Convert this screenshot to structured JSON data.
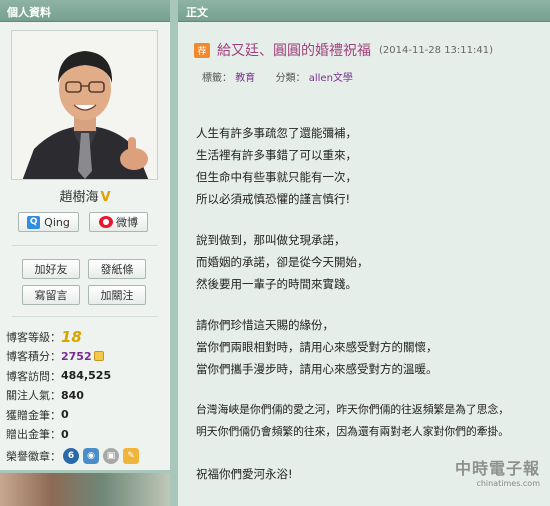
{
  "profile_panel": {
    "title": "個人資料",
    "name": "趙樹海",
    "vip_mark": "V",
    "buttons": {
      "qing": "Qing",
      "weibo": "微博",
      "add_friend": "加好友",
      "send_note": "發紙條",
      "write_message": "寫留言",
      "follow": "加關注"
    },
    "stats": [
      {
        "label": "博客等級：",
        "value": "18"
      },
      {
        "label": "博客積分：",
        "value": "2752"
      },
      {
        "label": "博客訪問：",
        "value": "484,525"
      },
      {
        "label": "關注人氣：",
        "value": "840"
      },
      {
        "label": "獲贈金筆：",
        "value": "0"
      },
      {
        "label": "贈出金筆：",
        "value": "0"
      },
      {
        "label": "榮譽徽章：",
        "value": ""
      }
    ],
    "badge_icons": [
      "medal-icon",
      "camera-icon",
      "lock-icon",
      "pen-icon"
    ],
    "badge_medal_number": "6"
  },
  "article_panel": {
    "title": "正文",
    "recommend_mark": "荐",
    "article_title": "給又廷、圓圓的婚禮祝福",
    "date": "(2014-11-28 13:11:41)",
    "tags_label": "標籤：",
    "tag": "教育",
    "category_label": "分類：",
    "category": "allen文學",
    "paragraphs": [
      [
        "人生有許多事疏忽了還能彌補，",
        "生活裡有許多事錯了可以重來，",
        "但生命中有些事就只能有一次，",
        "所以必須戒慎恐懼的謹言慎行!"
      ],
      [
        "說到做到，那叫做兌現承諾，",
        "而婚姻的承諾，卻是從今天開始，",
        "然後要用一輩子的時間來實踐。"
      ],
      [
        "請你們珍惜這天賜的緣份，",
        "當你們兩眼相對時，請用心來感受對方的關懷，",
        "當你們攜手漫步時，請用心來感受對方的溫暖。"
      ],
      [
        "台灣海峽是你們倆的愛之河，昨天你們倆的往返頻繁是為了思念，",
        "明天你們倆仍會頻繁的往來，因為還有兩對老人家對你們的牽掛。"
      ],
      [
        "祝福你們愛河永浴!"
      ]
    ]
  },
  "watermark": {
    "main": "中時電子報",
    "sub": "chinatimes.com"
  },
  "colors": {
    "panel_bg": "#eef3f0",
    "header_bg": "#76a090",
    "title": "#a0437d",
    "accent_purple": "#7a2f8f"
  }
}
